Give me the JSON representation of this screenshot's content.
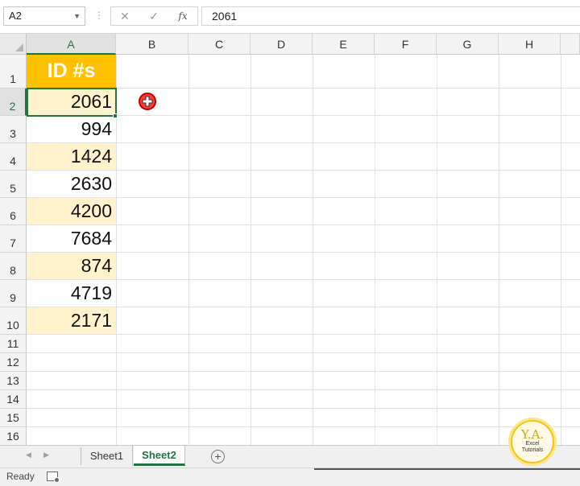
{
  "formula_bar": {
    "name_box": "A2",
    "name_box_arrow": "▼",
    "dots": "⋮",
    "cancel": "✕",
    "enter": "✓",
    "fx": "fx",
    "formula": "2061"
  },
  "columns": [
    "A",
    "B",
    "C",
    "D",
    "E",
    "F",
    "G",
    "H"
  ],
  "rows": [
    "1",
    "2",
    "3",
    "4",
    "5",
    "6",
    "7",
    "8",
    "9",
    "10",
    "11",
    "12",
    "13",
    "14",
    "15",
    "16"
  ],
  "cells": {
    "a1": "ID #s",
    "a2": "2061",
    "a3": "994",
    "a4": "1424",
    "a5": "2630",
    "a6": "4200",
    "a7": "7684",
    "a8": "874",
    "a9": "4719",
    "a10": "2171"
  },
  "active_cell": "A2",
  "colors": {
    "header_fill": "#ffc000",
    "band_fill": "#fff2cc",
    "accent": "#217346",
    "cursor": "#ff3b3b"
  },
  "tabs": {
    "prev": "◀",
    "next": "▶",
    "sheet1": "Sheet1",
    "sheet2": "Sheet2",
    "add": "+"
  },
  "status": {
    "text": "Ready"
  },
  "logo": {
    "initials": "Y.A.",
    "line1": "Excel",
    "line2": "Tutorials"
  }
}
